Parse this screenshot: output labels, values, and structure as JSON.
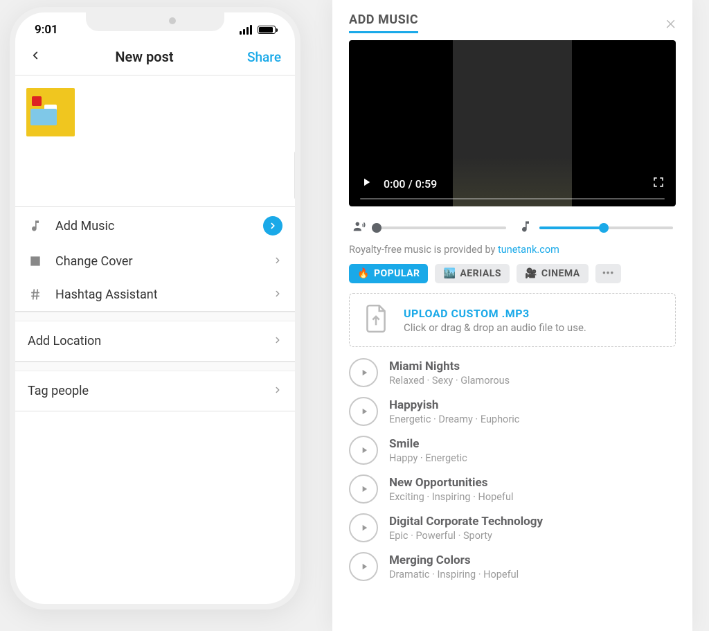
{
  "phone": {
    "time": "9:01",
    "header": {
      "title": "New post",
      "share": "Share"
    },
    "menu": {
      "add_music": "Add Music",
      "change_cover": "Change Cover",
      "hashtag_assistant": "Hashtag Assistant"
    },
    "add_location": "Add Location",
    "tag_people": "Tag people"
  },
  "panel": {
    "title": "ADD MUSIC",
    "video": {
      "timecode": "0:00 / 0:59"
    },
    "voice_slider_percent": 2,
    "music_slider_percent": 48,
    "credit_prefix": "Royalty-free music is provided by ",
    "credit_link": "tunetank.com",
    "tabs": [
      {
        "emoji": "🔥",
        "label": "POPULAR",
        "active": true
      },
      {
        "emoji": "🏙️",
        "label": "AERIALS",
        "active": false
      },
      {
        "emoji": "🎥",
        "label": "CINEMA",
        "active": false
      }
    ],
    "upload": {
      "title": "UPLOAD CUSTOM .MP3",
      "subtitle": "Click or drag & drop an audio file to use."
    },
    "tracks": [
      {
        "name": "Miami Nights",
        "tags": "Relaxed · Sexy · Glamorous"
      },
      {
        "name": "Happyish",
        "tags": "Energetic · Dreamy · Euphoric"
      },
      {
        "name": "Smile",
        "tags": "Happy · Energetic"
      },
      {
        "name": "New Opportunities",
        "tags": "Exciting · Inspiring · Hopeful"
      },
      {
        "name": "Digital Corporate Technology",
        "tags": "Epic · Powerful · Sporty"
      },
      {
        "name": "Merging Colors",
        "tags": "Dramatic · Inspiring · Hopeful"
      }
    ]
  }
}
